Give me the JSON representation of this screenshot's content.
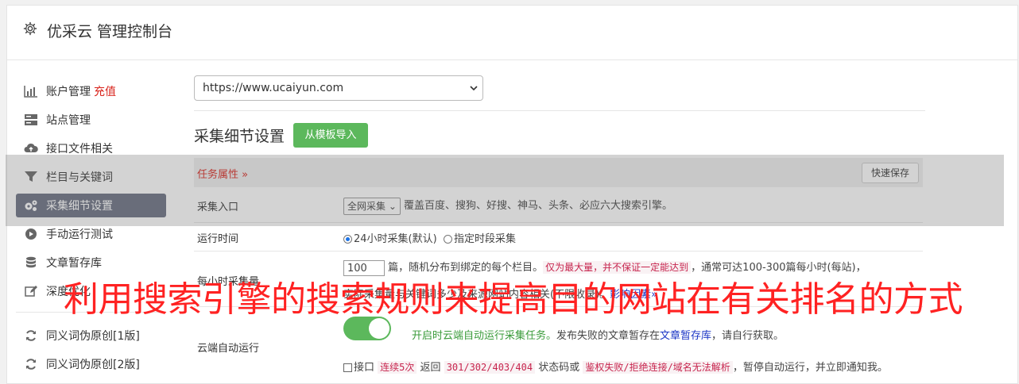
{
  "header": {
    "title": "优采云 管理控制台"
  },
  "sidebar": {
    "items": [
      {
        "label": "账户管理",
        "badge": "充值",
        "icon": "bar-chart-icon"
      },
      {
        "label": "站点管理",
        "icon": "server-icon"
      },
      {
        "label": "接口文件相关",
        "icon": "cloud-upload-icon"
      },
      {
        "label": "栏目与关键词",
        "icon": "filter-icon"
      },
      {
        "label": "采集细节设置",
        "icon": "gears-icon"
      },
      {
        "label": "手动运行测试",
        "icon": "play-circle-icon"
      },
      {
        "label": "文章暂存库",
        "icon": "database-icon"
      },
      {
        "label": "深度优化",
        "icon": "edit-icon"
      },
      {
        "label": "同义词伪原创[1版]",
        "icon": "refresh-icon"
      },
      {
        "label": "同义词伪原创[2版]",
        "icon": "refresh-icon"
      }
    ]
  },
  "site_select": {
    "value": "https://www.ucaiyun.com"
  },
  "section": {
    "title": "采集细节设置",
    "import_button": "从模板导入"
  },
  "task": {
    "header": "任务属性 »",
    "save_button": "快速保存"
  },
  "rows": {
    "entry": {
      "label": "采集入口",
      "select": "全网采集",
      "desc": "覆盖百度、搜狗、好搜、神马、头条、必应六大搜索引擎。"
    },
    "runtime": {
      "label": "运行时间",
      "opt1": "24小时采集(默认)",
      "opt2": "指定时段采集"
    },
    "perhour": {
      "label": "每小时采集量",
      "value": "100",
      "text1": "篇，随机分布到绑定的每个栏目。",
      "pink": "仅为最大量，并不保证一定能达到",
      "text2": "，通常可达100-300篇每小时(每站)，",
      "text3": "实际采集量与关键词多少及来源网站内容相关(不限收录)。",
      "link": "影响因素»"
    },
    "cloud": {
      "label": "云端自动运行",
      "on_text": "开启时云端自动运行采集任务。",
      "desc1": "发布失败的文章暂存在",
      "link": "文章暂存库",
      "desc2": "，请自行获取。",
      "chk_label": "接口",
      "pink1": "连续5次",
      "mid1": "返回",
      "pink2": "301/302/403/404",
      "mid2": "状态码或",
      "pink3": "鉴权失败/拒绝连接/域名无法解析",
      "tail": "，暂停自动运行，并立即通知我。"
    }
  },
  "overlay_text": "利用搜索引擎的搜索规则来提高目的网站在有关排名的方式",
  "colors": {
    "accent_green": "#5cb85c",
    "active_nav": "#676e80",
    "alert_red": "#d9251d",
    "overlay_red": "#ff2222"
  }
}
